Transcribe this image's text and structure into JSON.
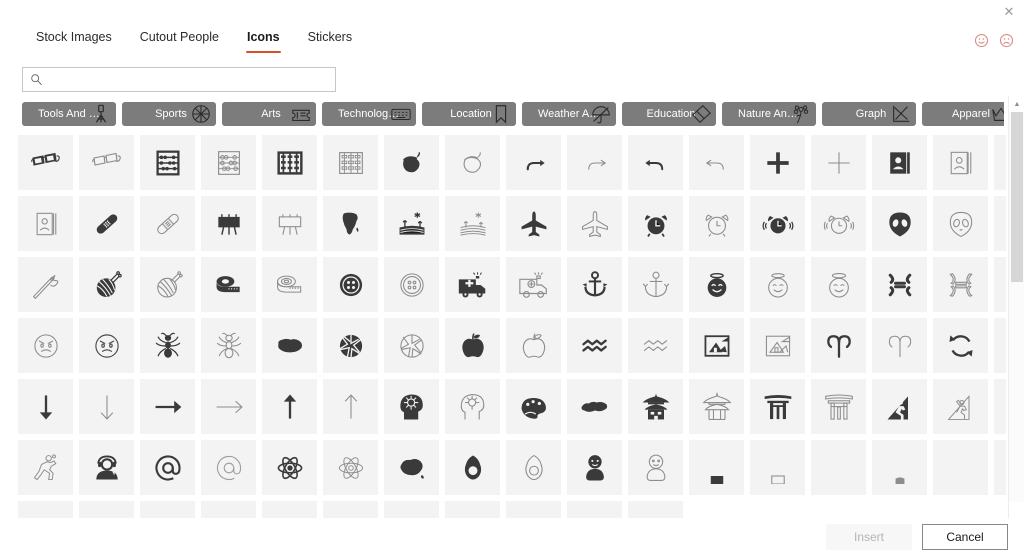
{
  "window": {
    "close_label": "✕"
  },
  "feedback": {
    "smile_name": "smiley-face-feedback",
    "frown_name": "frowny-face-feedback"
  },
  "tabs": [
    {
      "label": "Stock Images",
      "active": false
    },
    {
      "label": "Cutout People",
      "active": false
    },
    {
      "label": "Icons",
      "active": true
    },
    {
      "label": "Stickers",
      "active": false
    }
  ],
  "accent_color": "#d8502a",
  "search": {
    "value": "",
    "placeholder": "",
    "icon": "search-icon"
  },
  "categories": [
    {
      "label": "Tools And Buil...",
      "full": "Tools And Building",
      "icon": "tripod-icon"
    },
    {
      "label": "Sports",
      "icon": "basketball-icon"
    },
    {
      "label": "Arts",
      "icon": "tickets-icon"
    },
    {
      "label": "Technology An...",
      "full": "Technology And Electronics",
      "icon": "keyboard-icon"
    },
    {
      "label": "Location",
      "icon": "bookmark-icon"
    },
    {
      "label": "Weather And S...",
      "full": "Weather And Seasons",
      "icon": "umbrella-icon"
    },
    {
      "label": "Education",
      "icon": "eraser-icon"
    },
    {
      "label": "Nature And Ou...",
      "full": "Nature And Outdoors",
      "icon": "flower-icon"
    },
    {
      "label": "Graph",
      "icon": "line-chart-icon"
    },
    {
      "label": "Apparel",
      "icon": "crown-icon"
    }
  ],
  "chip_next_label": "›",
  "grid": {
    "columns": 17,
    "icons": [
      "3d-glasses-filled",
      "3d-glasses-outline",
      "abacus-filled",
      "abacus-outline",
      "abacus2-filled",
      "abacus2-outline",
      "acorn-filled",
      "acorn-outline",
      "arrow-merge-right-filled",
      "arrow-merge-right-outline",
      "arrow-merge-left-filled",
      "arrow-merge-left-outline",
      "add-plus-filled",
      "add-plus-outline",
      "address-book-filled",
      "address-book-outline",
      "address-book2-filled",
      "address-book2-outline",
      "adhesive-bandage-filled",
      "adhesive-bandage-outline",
      "advertising-board-filled",
      "advertising-board-outline",
      "africa-filled",
      "agriculture-filled",
      "agriculture-outline",
      "airplane-filled",
      "airplane-outline",
      "alarm-clock-filled",
      "alarm-clock-outline",
      "alarm-clock-ringing-filled",
      "alarm-clock-ringing-outline",
      "alien-filled",
      "alien-outline",
      "needle-thread-filled",
      "needle-thread-outline",
      "yarn-ball-filled",
      "yarn-ball-outline",
      "tape-measure-filled",
      "tape-measure-outline",
      "button-filled",
      "button-outline",
      "ambulance-filled",
      "ambulance-outline",
      "anchor-filled",
      "anchor-outline",
      "angel-face-filled",
      "angel-face-outline",
      "angel-face2-outline",
      "angry-symbol-filled",
      "angry-symbol-outline",
      "angry-face-filled",
      "angry-face-outline",
      "angry-face2-outline",
      "ant-filled",
      "ant-outline",
      "antarctica-filled",
      "aperture-filled",
      "aperture-outline",
      "apple-filled",
      "apple-outline",
      "aquarius-filled",
      "aquarius-outline",
      "architecture-filled",
      "architecture-outline",
      "aries-filled",
      "aries-outline",
      "recycle-filled",
      "recycle-outline",
      "arrow-down-filled",
      "arrow-down-outline",
      "arrow-right-filled",
      "arrow-right-outline",
      "arrow-up-filled",
      "arrow-up-outline",
      "brain-head-filled",
      "brain-head-outline",
      "artist-palette-filled",
      "switzerland-filled",
      "pagoda-filled",
      "pagoda-outline",
      "torii-gate-filled",
      "torii-gate-outline",
      "climbing-filled",
      "climbing-outline",
      "running-filled",
      "running-outline",
      "support-agent-filled",
      "at-sign-filled",
      "at-sign-outline",
      "atom-filled",
      "atom-outline",
      "australia-filled",
      "avocado-filled",
      "avocado-outline",
      "baby-filled",
      "baby-outline",
      "row7-a",
      "row7-b",
      "row7-c",
      "row7-d",
      "row7-e",
      "row7-f",
      "row7-g",
      "row7-h",
      "row7-i",
      "row7-j",
      "row7-k",
      "row7-l",
      "row7-m",
      "row7-n",
      "row7-o",
      "row7-p",
      "row7-q"
    ]
  },
  "scrollbar": {
    "up_label": "▲",
    "down_label": "▼"
  },
  "footer": {
    "insert_label": "Insert",
    "insert_enabled": false,
    "cancel_label": "Cancel"
  }
}
